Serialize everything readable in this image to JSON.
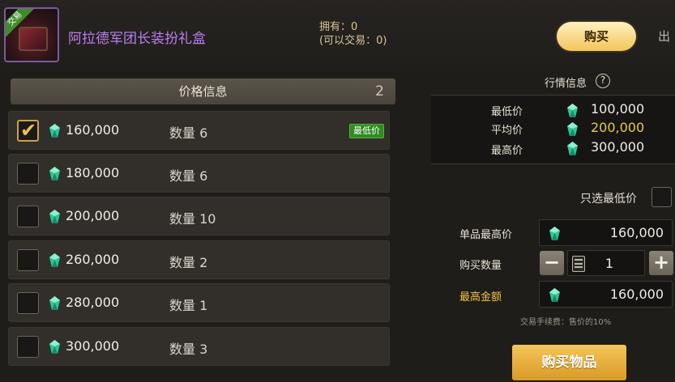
{
  "header": {
    "item_badge": "交易",
    "item_name": "阿拉德军团长装扮礼盒",
    "owned": "拥有：0",
    "tradable": "(可以交易：0)",
    "tab_buy": "购买",
    "tab_sell": "出"
  },
  "price_panel": {
    "title": "价格信息",
    "page": "2",
    "lowest_badge": "最低价",
    "listings": [
      {
        "price": "160,000",
        "qty": "数量 6",
        "selected": true,
        "lowest": true
      },
      {
        "price": "180,000",
        "qty": "数量 6",
        "selected": false,
        "lowest": false
      },
      {
        "price": "200,000",
        "qty": "数量 10",
        "selected": false,
        "lowest": false
      },
      {
        "price": "260,000",
        "qty": "数量 2",
        "selected": false,
        "lowest": false
      },
      {
        "price": "280,000",
        "qty": "数量 1",
        "selected": false,
        "lowest": false
      },
      {
        "price": "300,000",
        "qty": "数量 3",
        "selected": false,
        "lowest": false
      }
    ]
  },
  "market": {
    "title": "行情信息",
    "help": "?",
    "min_label": "最低价",
    "min_value": "100,000",
    "avg_label": "平均价",
    "avg_value": "200,000",
    "max_label": "最高价",
    "max_value": "300,000"
  },
  "purchase": {
    "only_lowest_label": "只选最低价",
    "unit_max_label": "单品最高价",
    "unit_max_value": "160,000",
    "qty_label": "购买数量",
    "qty_value": "1",
    "minus": "−",
    "plus": "+",
    "total_label": "最高金额",
    "total_value": "160,000",
    "fee_note": "交易手续费：售价的10%",
    "buy_button": "购买物品"
  },
  "colors": {
    "accent_gold": "#f2c24a",
    "item_name_purple": "#b97ff0",
    "lowest_badge_green": "#2f8b21",
    "avg_value_yellow": "#e8c84a",
    "gem_teal": "#3fd6a6"
  },
  "icons": [
    "gem-icon",
    "help-icon",
    "calculator-icon",
    "check-icon"
  ]
}
